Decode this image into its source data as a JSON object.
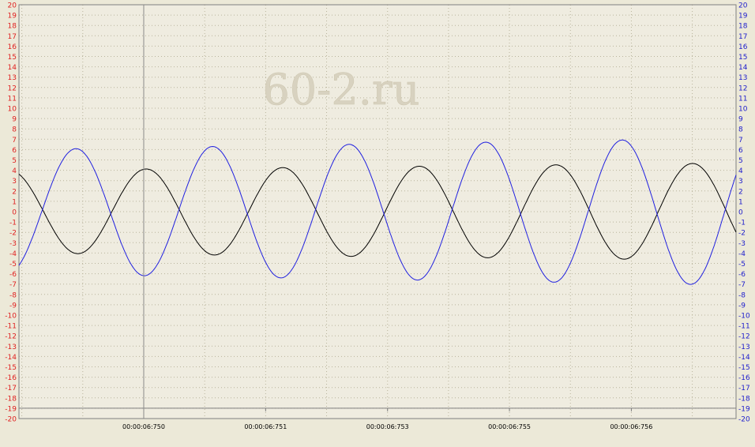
{
  "colors": {
    "background": "#ece9d8",
    "plot_background": "#efece0",
    "grid": "#b9b49c",
    "axis": "#7f7f7f",
    "left_axis_labels": "#e02020",
    "right_axis_labels": "#1c1ccc",
    "x_labels": "#000000",
    "watermark": "#d8d2c0"
  },
  "watermark_text": "60-2.ru",
  "chart_data": {
    "type": "line",
    "title": "",
    "xlabel": "",
    "ylabel": "",
    "ylim": [
      -20,
      20
    ],
    "y2lim": [
      -20,
      20
    ],
    "xlim": [
      0,
      100
    ],
    "grid": true,
    "legend": "none",
    "x_ticks": [
      {
        "x": 17.4,
        "label": "00:00:06:750"
      },
      {
        "x": 34.4,
        "label": "00:00:06:751"
      },
      {
        "x": 51.4,
        "label": "00:00:06:753"
      },
      {
        "x": 68.4,
        "label": "00:00:06:755"
      },
      {
        "x": 85.4,
        "label": "00:00:06:756"
      }
    ],
    "cursor_x": 17.4,
    "series": [
      {
        "color": "#000000",
        "axis": "left",
        "shape": {
          "amp_start": 4.0,
          "amp_end": 4.7,
          "phase_deg": 115,
          "periods": 5.25
        },
        "x": [
          0,
          1.1,
          2.2,
          3.3,
          4.4,
          5.5,
          6.6,
          7.7,
          8.8,
          9.9,
          11.0,
          12.1,
          13.2,
          14.3,
          15.4,
          16.5,
          17.6,
          18.7,
          19.8,
          20.9,
          22.0,
          23.1,
          24.2,
          25.3,
          26.4,
          27.5,
          28.6,
          29.7,
          30.8,
          31.9,
          33.0,
          34.1,
          35.2,
          36.3,
          37.4,
          38.5,
          39.6,
          40.7,
          41.8,
          42.9,
          44.0,
          45.1,
          46.2,
          47.3,
          48.4,
          49.5,
          50.6,
          51.7,
          52.8,
          53.9,
          55.0,
          56.1,
          57.2,
          58.3,
          59.4,
          60.5,
          61.6,
          62.7,
          63.8,
          64.9,
          66.0,
          67.1,
          68.2,
          69.3,
          70.4,
          71.5,
          72.6,
          73.7,
          74.8,
          75.9,
          77.0,
          78.1,
          79.2,
          80.3,
          81.4,
          82.5,
          83.6,
          84.7,
          85.8,
          86.9,
          88.0,
          89.1,
          90.2,
          91.3,
          92.4,
          93.5,
          94.6,
          95.7,
          96.8,
          97.9,
          99.0,
          100
        ],
        "values": [
          1.7,
          0.6,
          -0.8,
          -1.9,
          -2.9,
          -3.5,
          -3.9,
          -4.0,
          -3.8,
          -3.2,
          -2.3,
          -1.1,
          0.3,
          1.6,
          2.8,
          3.6,
          4.1,
          4.1,
          3.7,
          2.9,
          1.8,
          0.5,
          -0.9,
          -2.1,
          -3.1,
          -3.8,
          -4.1,
          -4.0,
          -3.5,
          -2.5,
          -1.2,
          0.3,
          1.7,
          2.9,
          3.8,
          4.2,
          4.2,
          3.6,
          2.6,
          1.3,
          -0.2,
          -1.6,
          -2.9,
          -3.8,
          -4.3,
          -4.3,
          -3.8,
          -2.8,
          -1.4,
          0.1,
          1.6,
          2.9,
          3.9,
          4.4,
          4.4,
          3.9,
          2.9,
          1.5,
          -0.1,
          -1.6,
          -3.0,
          -4.0,
          -4.5,
          -4.5,
          -4.0,
          -2.9,
          -1.5,
          0.1,
          1.7,
          3.0,
          4.0,
          4.5,
          4.5,
          4.0,
          2.9,
          1.5,
          -0.1,
          -1.7,
          -3.1,
          -4.1,
          -4.6,
          -4.6,
          -4.0,
          -2.9,
          -1.4,
          0.2,
          1.8,
          3.2,
          4.2,
          4.7,
          4.6,
          3.9
        ]
      },
      {
        "color": "#2020e0",
        "axis": "right",
        "shape": {
          "amp_start": 6.0,
          "amp_end": 7.1,
          "phase_deg": -60,
          "periods": 5.25
        },
        "x": [
          0,
          1.1,
          2.2,
          3.3,
          4.4,
          5.5,
          6.6,
          7.7,
          8.8,
          9.9,
          11.0,
          12.1,
          13.2,
          14.3,
          15.4,
          16.5,
          17.6,
          18.7,
          19.8,
          20.9,
          22.0,
          23.1,
          24.2,
          25.3,
          26.4,
          27.5,
          28.6,
          29.7,
          30.8,
          31.9,
          33.0,
          34.1,
          35.2,
          36.3,
          37.4,
          38.5,
          39.6,
          40.7,
          41.8,
          42.9,
          44.0,
          45.1,
          46.2,
          47.3,
          48.4,
          49.5,
          50.6,
          51.7,
          52.8,
          53.9,
          55.0,
          56.1,
          57.2,
          58.3,
          59.4,
          60.5,
          61.6,
          62.7,
          63.8,
          64.9,
          66.0,
          67.1,
          68.2,
          69.3,
          70.4,
          71.5,
          72.6,
          73.7,
          74.8,
          75.9,
          77.0,
          78.1,
          79.2,
          80.3,
          81.4,
          82.5,
          83.6,
          84.7,
          85.8,
          86.9,
          88.0,
          89.1,
          90.2,
          91.3,
          92.4,
          93.5,
          94.6,
          95.7,
          96.8,
          97.9,
          99.0,
          100
        ],
        "values": [
          -2.6,
          -0.6,
          1.4,
          3.2,
          4.7,
          5.7,
          6.1,
          5.9,
          5.1,
          3.7,
          1.9,
          -0.1,
          -2.1,
          -3.9,
          -5.2,
          -6.0,
          -6.1,
          -5.6,
          -4.4,
          -2.7,
          -0.7,
          1.4,
          3.3,
          4.9,
          6.0,
          6.4,
          6.2,
          5.3,
          3.8,
          1.9,
          -0.3,
          -2.4,
          -4.2,
          -5.6,
          -6.4,
          -6.4,
          -5.8,
          -4.5,
          -2.6,
          -0.5,
          1.7,
          3.7,
          5.3,
          6.3,
          6.6,
          6.2,
          5.1,
          3.4,
          1.3,
          -0.9,
          -3.0,
          -4.9,
          -6.2,
          -6.7,
          -6.6,
          -5.7,
          -4.1,
          -2.1,
          0.2,
          2.4,
          4.4,
          5.9,
          6.8,
          6.9,
          6.3,
          4.9,
          3.0,
          0.8,
          -1.5,
          -3.6,
          -5.4,
          -6.6,
          -7.0,
          -6.7,
          -5.6,
          -3.9,
          -1.7,
          0.6,
          2.9,
          4.9,
          6.4,
          7.1,
          7.1,
          6.3,
          4.7,
          2.6,
          0.3,
          -2.1,
          -4.3,
          -6.0,
          -7.0,
          -6.8
        ]
      }
    ]
  }
}
